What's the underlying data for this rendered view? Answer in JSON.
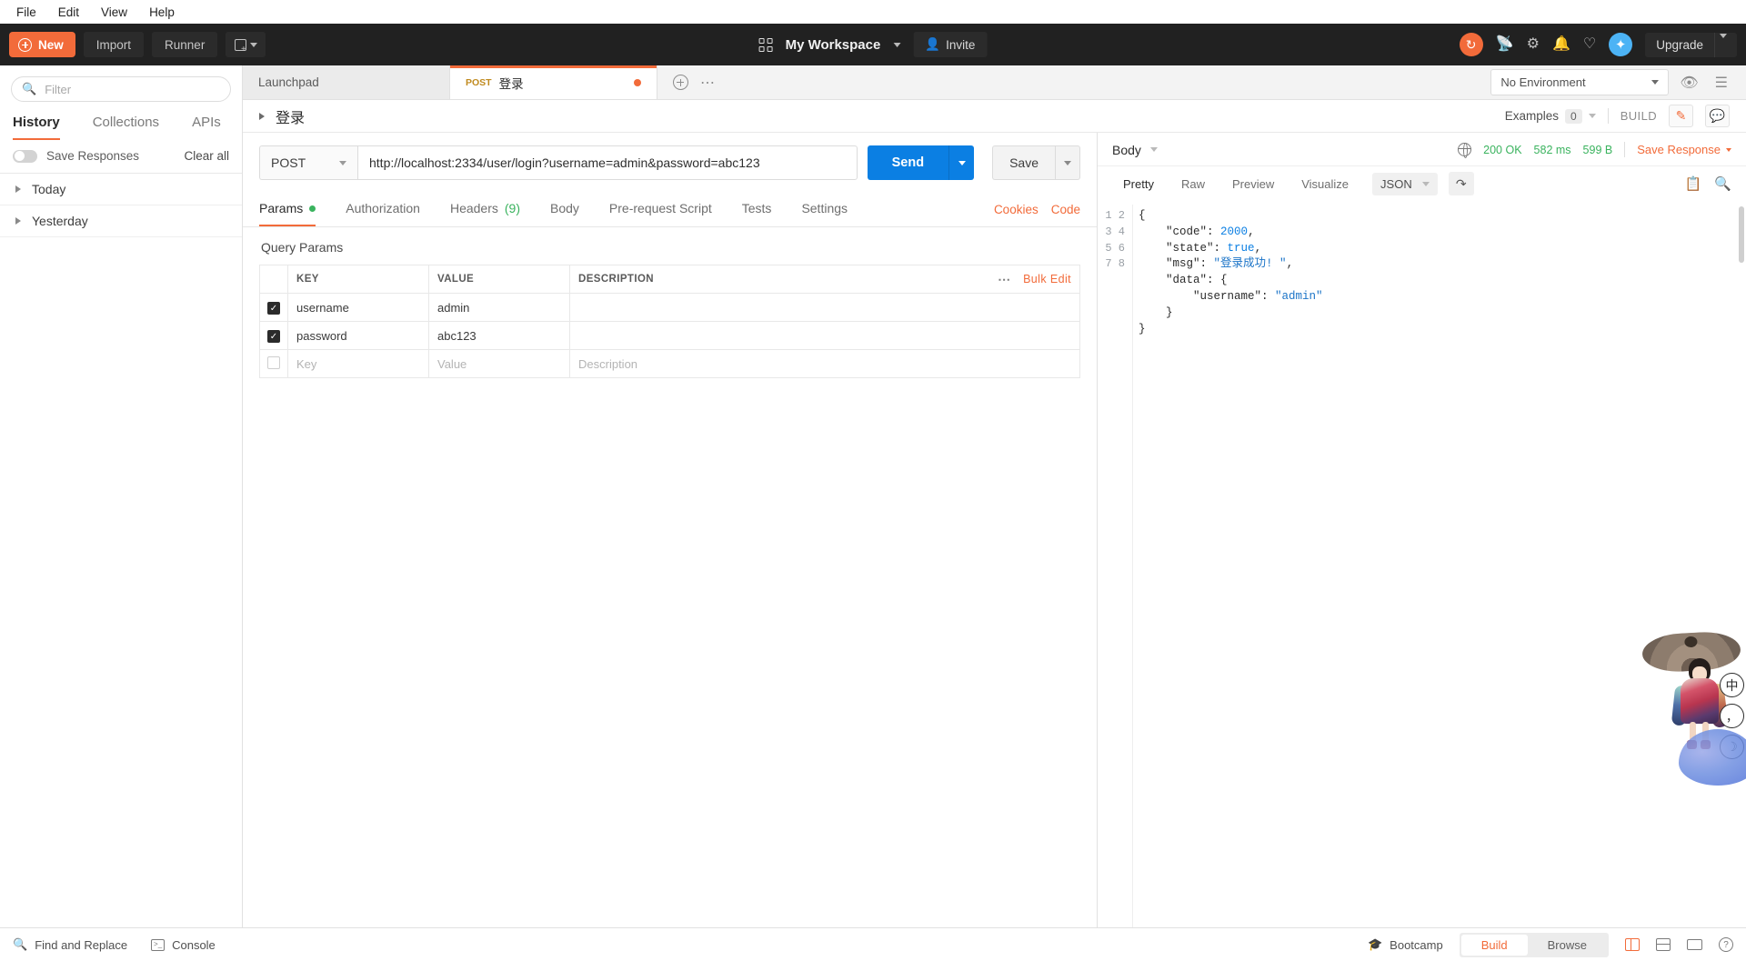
{
  "os_menu": [
    "File",
    "Edit",
    "View",
    "Help"
  ],
  "header": {
    "new_label": "New",
    "import_label": "Import",
    "runner_label": "Runner",
    "workspace_name": "My Workspace",
    "invite_label": "Invite",
    "upgrade_label": "Upgrade",
    "accent_orange": "#f26b3a",
    "avatar_blue": "#4cb3f5"
  },
  "sidebar": {
    "filter_placeholder": "Filter",
    "tabs": [
      {
        "label": "History",
        "active": true
      },
      {
        "label": "Collections",
        "active": false
      },
      {
        "label": "APIs",
        "active": false
      }
    ],
    "save_responses_label": "Save Responses",
    "clear_all_label": "Clear all",
    "history_groups": [
      "Today",
      "Yesterday"
    ]
  },
  "tabbar": {
    "tabs": [
      {
        "label": "Launchpad",
        "method": "",
        "active": false,
        "unsaved": false
      },
      {
        "label": "登录",
        "method": "POST",
        "active": true,
        "unsaved": true
      }
    ],
    "environment_value": "No Environment"
  },
  "request_title": {
    "name": "登录",
    "examples_label": "Examples",
    "examples_count": "0",
    "build_label": "BUILD"
  },
  "request": {
    "method": "POST",
    "url": "http://localhost:2334/user/login?username=admin&password=abc123",
    "send_label": "Send",
    "save_label": "Save",
    "tabs": [
      {
        "label": "Params",
        "active": true,
        "dot": true,
        "count": ""
      },
      {
        "label": "Authorization",
        "active": false,
        "dot": false,
        "count": ""
      },
      {
        "label": "Headers",
        "active": false,
        "dot": false,
        "count": "(9)"
      },
      {
        "label": "Body",
        "active": false,
        "dot": false,
        "count": ""
      },
      {
        "label": "Pre-request Script",
        "active": false,
        "dot": false,
        "count": ""
      },
      {
        "label": "Tests",
        "active": false,
        "dot": false,
        "count": ""
      },
      {
        "label": "Settings",
        "active": false,
        "dot": false,
        "count": ""
      }
    ],
    "cookies_label": "Cookies",
    "code_label": "Code"
  },
  "params": {
    "section_title": "Query Params",
    "bulk_edit_label": "Bulk Edit",
    "columns": [
      "KEY",
      "VALUE",
      "DESCRIPTION"
    ],
    "rows": [
      {
        "checked": true,
        "key": "username",
        "value": "admin",
        "description": ""
      },
      {
        "checked": true,
        "key": "password",
        "value": "abc123",
        "description": ""
      }
    ],
    "placeholder_row": {
      "key": "Key",
      "value": "Value",
      "description": "Description"
    }
  },
  "response": {
    "body_label": "Body",
    "status": "200 OK",
    "time": "582 ms",
    "size": "599 B",
    "save_response_label": "Save Response",
    "view_tabs": [
      {
        "label": "Pretty",
        "active": true
      },
      {
        "label": "Raw",
        "active": false
      },
      {
        "label": "Preview",
        "active": false
      },
      {
        "label": "Visualize",
        "active": false
      }
    ],
    "format": "JSON",
    "line_numbers": [
      "1",
      "2",
      "3",
      "4",
      "5",
      "6",
      "7",
      "8"
    ],
    "body_json": "{\n    \"code\": 2000,\n    \"state\": true,\n    \"msg\": \"登录成功! \",\n    \"data\": {\n        \"username\": \"admin\"\n    }\n}"
  },
  "ime_widget": {
    "buttons": [
      "中",
      "，",
      "☽"
    ]
  },
  "footer": {
    "find_replace_label": "Find and Replace",
    "console_label": "Console",
    "bootcamp_label": "Bootcamp",
    "build_label": "Build",
    "browse_label": "Browse"
  }
}
